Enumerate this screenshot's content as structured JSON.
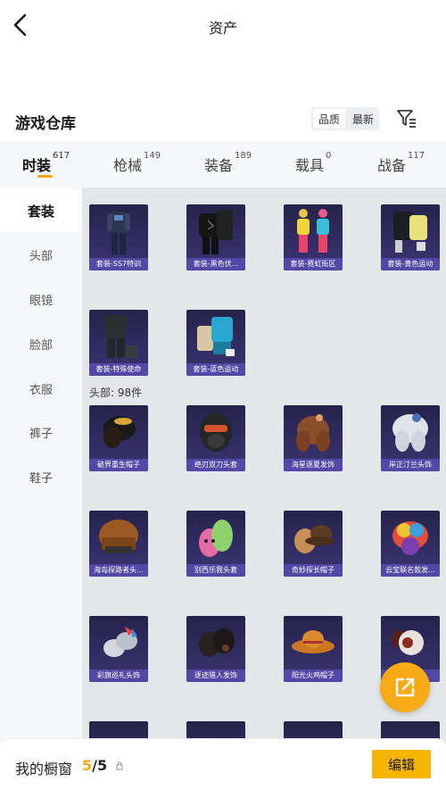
{
  "header": {
    "title": "资产"
  },
  "warehouse": {
    "title": "游戏仓库",
    "sort_quality": "品质",
    "sort_latest": "最新"
  },
  "tabs": [
    {
      "label": "时装",
      "count": "617"
    },
    {
      "label": "枪械",
      "count": "149"
    },
    {
      "label": "装备",
      "count": "189"
    },
    {
      "label": "载具",
      "count": "0"
    },
    {
      "label": "战备",
      "count": "117"
    }
  ],
  "sidenav": [
    "套装",
    "头部",
    "眼镜",
    "脸部",
    "衣服",
    "裤子",
    "鞋子"
  ],
  "section_head": "头部: 98件",
  "suits": [
    {
      "label": "套装-SS7特训",
      "icon": "suit-dark-icon"
    },
    {
      "label": "套装-黑色伏...",
      "icon": "suit-black-icon"
    },
    {
      "label": "套装-霓虹街区",
      "icon": "suit-neon-icon"
    },
    {
      "label": "套装-黄色运动",
      "icon": "suit-yellow-icon"
    },
    {
      "label": "套装-特殊使命",
      "icon": "suit-tactical-icon"
    },
    {
      "label": "套装-蓝色运动",
      "icon": "suit-blue-icon"
    }
  ],
  "headwear": [
    {
      "label": "破界重生帽子",
      "icon": "hat-icon"
    },
    {
      "label": "绝刃双刀头套",
      "icon": "helmet-icon"
    },
    {
      "label": "海星逐夏发饰",
      "icon": "hair-icon"
    },
    {
      "label": "岸正汀兰头饰",
      "icon": "hair-white-icon"
    },
    {
      "label": "海岛探路者头...",
      "icon": "hair-brown-icon"
    },
    {
      "label": "别西乐我头套",
      "icon": "mask-green-icon"
    },
    {
      "label": "奇妙探长帽子",
      "icon": "detective-hat-icon"
    },
    {
      "label": "云宝联名款发...",
      "icon": "hair-rainbow-icon"
    },
    {
      "label": "彩旗巡礼头饰",
      "icon": "headpiece-icon"
    },
    {
      "label": "逐迹猎人发饰",
      "icon": "hair-dark-icon"
    },
    {
      "label": "阳光火鸡帽子",
      "icon": "cowboy-hat-icon"
    },
    {
      "label": "...饰",
      "icon": "hair-red-icon"
    }
  ],
  "showcase": {
    "label": "我的橱窗",
    "current": "5",
    "total": "/5",
    "edit_label": "编辑"
  }
}
